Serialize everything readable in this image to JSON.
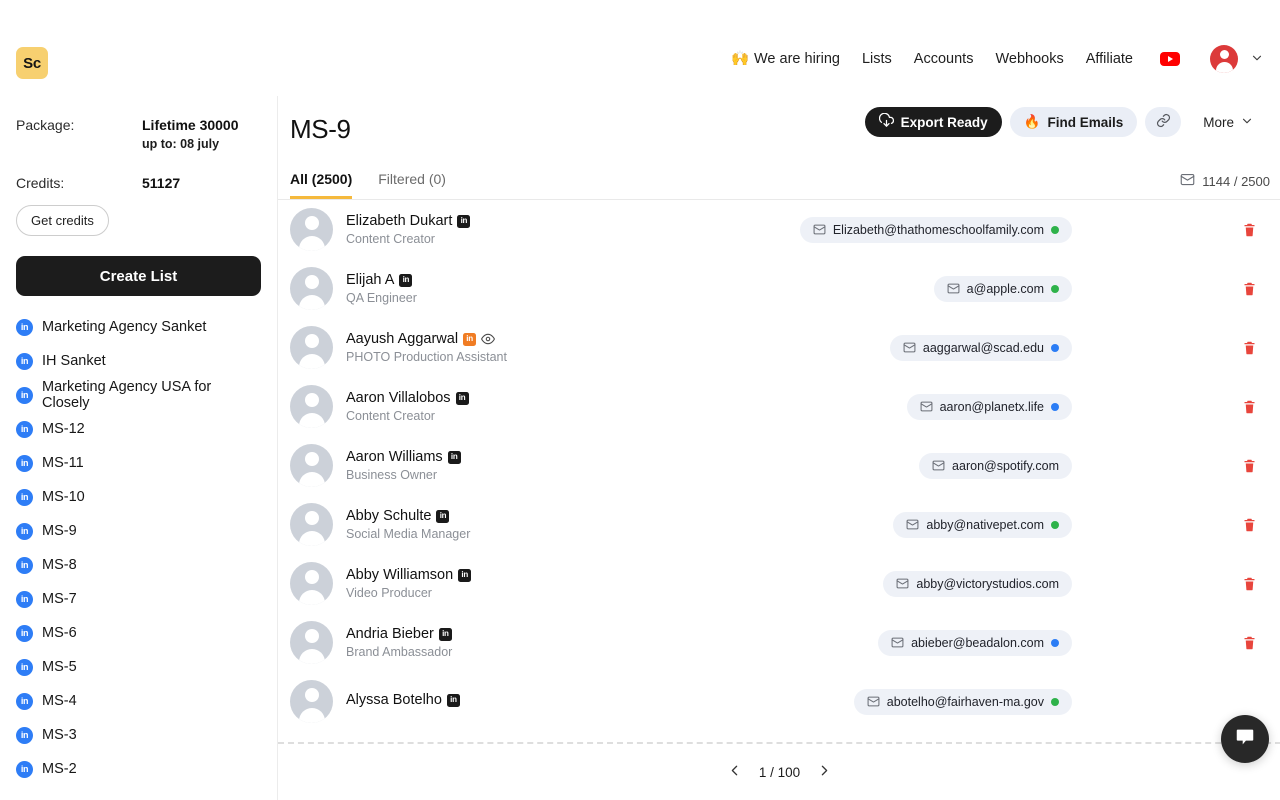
{
  "brand": {
    "logo_text": "Sc",
    "logo_bg": "#f7d070"
  },
  "topnav": {
    "items": [
      {
        "label": "We are hiring",
        "icon": "raising-hands-emoji",
        "emoji": "🙌"
      },
      {
        "label": "Lists",
        "icon": null
      },
      {
        "label": "Accounts",
        "icon": null
      },
      {
        "label": "Webhooks",
        "icon": null
      },
      {
        "label": "Affiliate",
        "icon": null
      }
    ],
    "youtube_icon": "youtube-icon",
    "avatar_icon": "user-avatar-icon",
    "avatar_color": "#dc3a3a",
    "chevron": "⌄"
  },
  "sidebar": {
    "package_label": "Package:",
    "package_value": "Lifetime 30000",
    "package_sub": "up to: 08 july",
    "credits_label": "Credits:",
    "credits_value": "51127",
    "get_credits_label": "Get credits",
    "create_list_label": "Create List",
    "list_icon": "in",
    "items": [
      {
        "label": "Marketing Agency Sanket"
      },
      {
        "label": "IH Sanket"
      },
      {
        "label": "Marketing Agency USA for Closely"
      },
      {
        "label": "MS-12"
      },
      {
        "label": "MS-11"
      },
      {
        "label": "MS-10"
      },
      {
        "label": "MS-9"
      },
      {
        "label": "MS-8"
      },
      {
        "label": "MS-7"
      },
      {
        "label": "MS-6"
      },
      {
        "label": "MS-5"
      },
      {
        "label": "MS-4"
      },
      {
        "label": "MS-3"
      },
      {
        "label": "MS-2"
      }
    ]
  },
  "main": {
    "title": "MS-9",
    "actions": {
      "export_label": "Export Ready",
      "export_icon": "cloud-download-icon",
      "find_emails_label": "Find Emails",
      "find_emails_icon": "fire-emoji",
      "find_emails_emoji": "🔥",
      "link_icon": "link-icon",
      "more_label": "More",
      "more_icon": "chevron-down-icon"
    },
    "tabs": [
      {
        "label": "All (2500)",
        "active": true
      },
      {
        "label": "Filtered (0)",
        "active": false
      }
    ],
    "mail_count": "1144 / 2500",
    "mail_count_icon": "envelope-icon",
    "accent_tab_color": "#f5b93c",
    "rows": [
      {
        "name": "Elizabeth Dukart",
        "title": "Content Creator",
        "badge": "in",
        "badge_color": "dark",
        "eye": false,
        "email": "Elizabeth@thathomeschoolfamily.com",
        "dot": "green",
        "trash": true
      },
      {
        "name": "Elijah A",
        "title": "QA Engineer",
        "badge": "in",
        "badge_color": "dark",
        "eye": false,
        "email": "a@apple.com",
        "dot": "green",
        "trash": true
      },
      {
        "name": "Aayush Aggarwal",
        "title": "PHOTO Production Assistant",
        "badge": "in",
        "badge_color": "orange",
        "eye": true,
        "email": "aaggarwal@scad.edu",
        "dot": "blue",
        "trash": true
      },
      {
        "name": "Aaron Villalobos",
        "title": "Content Creator",
        "badge": "in",
        "badge_color": "dark",
        "eye": false,
        "email": "aaron@planetx.life",
        "dot": "blue",
        "trash": true
      },
      {
        "name": "Aaron Williams",
        "title": "Business Owner",
        "badge": "in",
        "badge_color": "dark",
        "eye": false,
        "email": "aaron@spotify.com",
        "dot": "none",
        "trash": true
      },
      {
        "name": "Abby Schulte",
        "title": "Social Media Manager",
        "badge": "in",
        "badge_color": "dark",
        "eye": false,
        "email": "abby@nativepet.com",
        "dot": "green",
        "trash": true
      },
      {
        "name": "Abby Williamson",
        "title": "Video Producer",
        "badge": "in",
        "badge_color": "dark",
        "eye": false,
        "email": "abby@victorystudios.com",
        "dot": "none",
        "trash": true
      },
      {
        "name": "Andria Bieber",
        "title": "Brand Ambassador",
        "badge": "in",
        "badge_color": "dark",
        "eye": false,
        "email": "abieber@beadalon.com",
        "dot": "blue",
        "trash": true
      },
      {
        "name": "Alyssa Botelho",
        "title": "",
        "badge": "in",
        "badge_color": "dark",
        "eye": false,
        "email": "abotelho@fairhaven-ma.gov",
        "dot": "green",
        "trash": false
      }
    ],
    "pagination": {
      "prev_icon": "chevron-left-icon",
      "page_text": "1 / 100",
      "next_icon": "chevron-right-icon"
    }
  },
  "chat_widget": {
    "icon": "chat-bubble-icon"
  }
}
